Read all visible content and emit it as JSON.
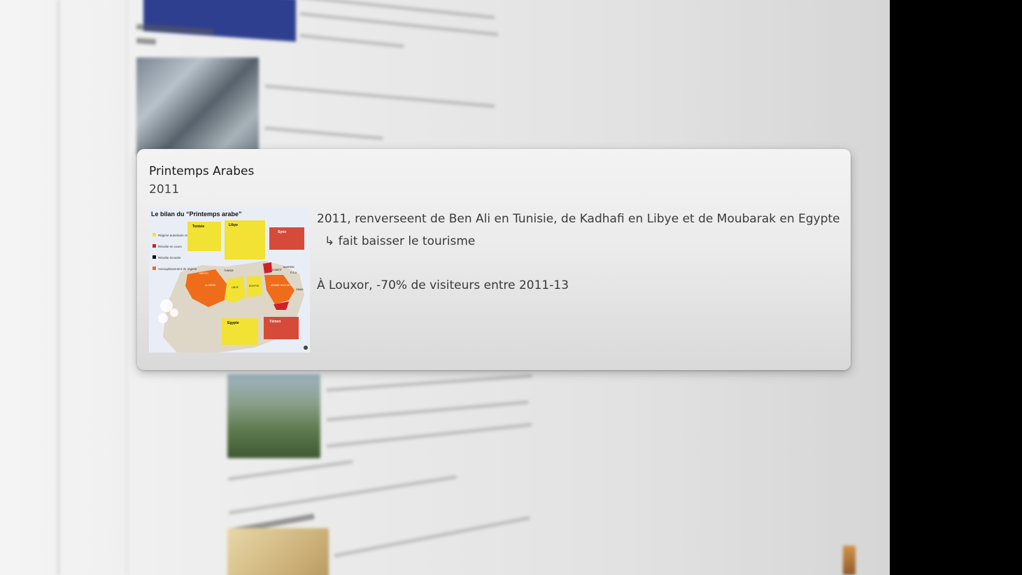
{
  "card": {
    "title": "Printemps Arabes",
    "year": "2011",
    "line1": "2011, renverseent de Ben Ali en Tunisie, de Kadhafi en Libye et de Moubarak en Egypte",
    "line2": "↳ fait baisser le tourisme",
    "line3": "À Louxor, -70% de visiteurs entre 2011-13",
    "image": {
      "heading": "Le bilan du “Printemps arabe”",
      "legend": [
        {
          "label": "Régime autoritaire renversé",
          "color": "#f2e233"
        },
        {
          "label": "Révolte en cours",
          "color": "#d0212b"
        },
        {
          "label": "Révolte écrasée",
          "color": "#111111"
        },
        {
          "label": "Assouplissement du régime",
          "color": "#ef6c1a"
        }
      ],
      "boxes": {
        "tunisie": "Tunisie",
        "libye": "Libye",
        "syrie": "Syrie",
        "egypte": "Egypte",
        "yemen": "Yémen"
      },
      "countries": {
        "algerie": "ALGÉRIE",
        "libye": "LIBYE",
        "egypte": "ÉGYPTE",
        "arabie": "ARABIE SAOUDITE",
        "maroc": "MAROC",
        "tunisie": "TUNISIE",
        "koweit": "KOWEÏT",
        "bahrein": "BAHREÏN",
        "eau": "É.A.U.",
        "oman": "OMAN"
      }
    }
  }
}
